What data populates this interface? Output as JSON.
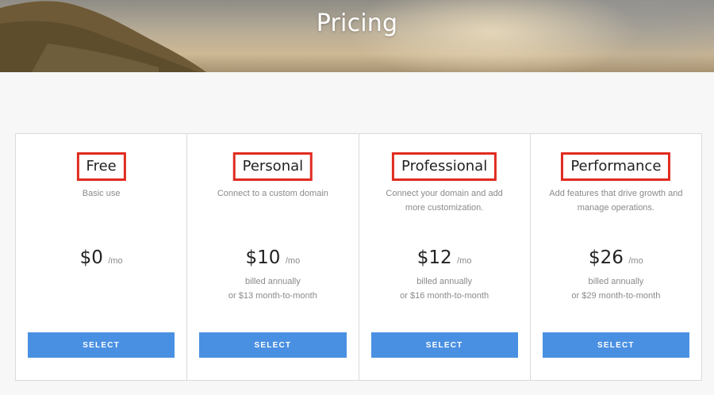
{
  "header": {
    "title": "Pricing"
  },
  "plans": [
    {
      "name": "Free",
      "description": "Basic use",
      "price": "$0",
      "per": "/mo",
      "billing_line1": "",
      "billing_line2": "",
      "button": "SELECT"
    },
    {
      "name": "Personal",
      "description": "Connect to a custom domain",
      "price": "$10",
      "per": "/mo",
      "billing_line1": "billed annually",
      "billing_line2": "or $13 month-to-month",
      "button": "SELECT"
    },
    {
      "name": "Professional",
      "description": "Connect your domain and add more customization.",
      "price": "$12",
      "per": "/mo",
      "billing_line1": "billed annually",
      "billing_line2": "or $16 month-to-month",
      "button": "SELECT"
    },
    {
      "name": "Performance",
      "description": "Add features that drive growth and manage operations.",
      "price": "$26",
      "per": "/mo",
      "billing_line1": "billed annually",
      "billing_line2": "or $29 month-to-month",
      "button": "SELECT"
    }
  ],
  "colors": {
    "accent": "#4a90e2",
    "highlight_border": "#e02b20",
    "background": "#f7f7f7"
  }
}
